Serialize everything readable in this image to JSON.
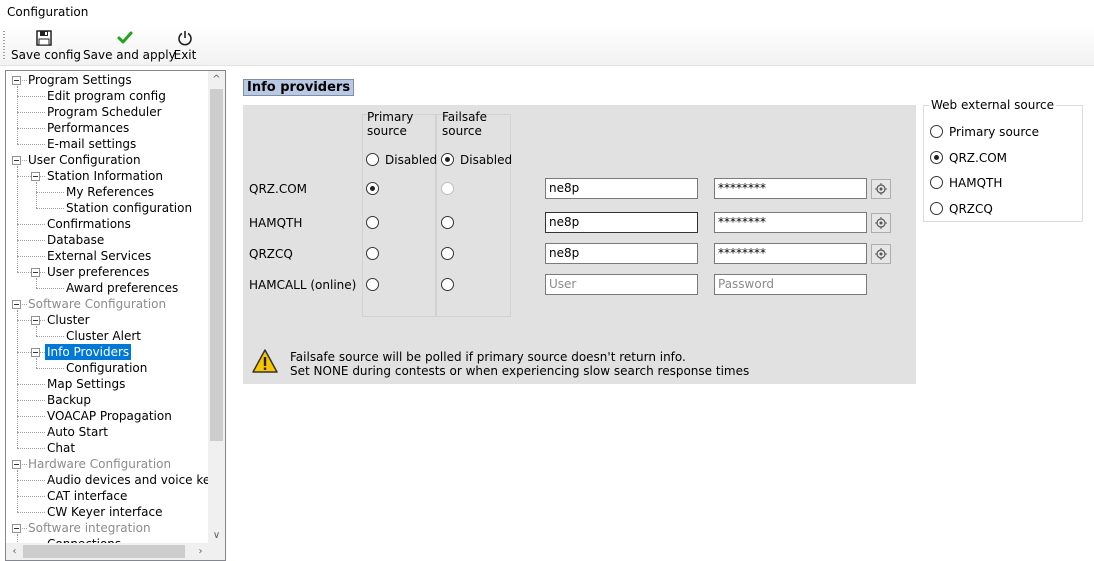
{
  "window": {
    "title": "Configuration"
  },
  "toolbar": {
    "save_config": "Save config",
    "save_and_apply": "Save and apply",
    "exit": "Exit"
  },
  "tree": {
    "items": [
      {
        "label": "Program Settings",
        "level": 0,
        "group": true
      },
      {
        "label": "Edit program config",
        "level": 1
      },
      {
        "label": "Program Scheduler",
        "level": 1
      },
      {
        "label": "Performances",
        "level": 1
      },
      {
        "label": "E-mail settings",
        "level": 1
      },
      {
        "label": "User Configuration",
        "level": 0,
        "group": true
      },
      {
        "label": "Station Information",
        "level": 1,
        "group": true
      },
      {
        "label": "My References",
        "level": 2
      },
      {
        "label": "Station configuration",
        "level": 2
      },
      {
        "label": "Confirmations",
        "level": 1
      },
      {
        "label": "Database",
        "level": 1
      },
      {
        "label": "External Services",
        "level": 1
      },
      {
        "label": "User preferences",
        "level": 1,
        "group": true
      },
      {
        "label": "Award preferences",
        "level": 2
      },
      {
        "label": "Software Configuration",
        "level": 0,
        "group": true,
        "grey": true
      },
      {
        "label": "Cluster",
        "level": 1,
        "group": true
      },
      {
        "label": "Cluster Alert",
        "level": 2
      },
      {
        "label": "Info Providers",
        "level": 1,
        "group": true,
        "selected": true
      },
      {
        "label": "Configuration",
        "level": 2
      },
      {
        "label": "Map Settings",
        "level": 1
      },
      {
        "label": "Backup",
        "level": 1
      },
      {
        "label": "VOACAP Propagation",
        "level": 1
      },
      {
        "label": "Auto Start",
        "level": 1
      },
      {
        "label": "Chat",
        "level": 1
      },
      {
        "label": "Hardware Configuration",
        "level": 0,
        "group": true,
        "grey": true
      },
      {
        "label": "Audio devices and voice keyer",
        "level": 1
      },
      {
        "label": "CAT interface",
        "level": 1
      },
      {
        "label": "CW Keyer interface",
        "level": 1
      },
      {
        "label": "Software integration",
        "level": 0,
        "group": true,
        "grey": true
      },
      {
        "label": "Connections",
        "level": 1
      }
    ]
  },
  "panel": {
    "title": "Info providers",
    "primary_header": "Primary\nsource",
    "failsafe_header": "Failsafe\nsource",
    "primary_disabled_label": "Disabled",
    "failsafe_disabled_label": "Disabled",
    "rows": [
      {
        "name": "QRZ.COM",
        "user": "ne8p",
        "password": "********",
        "primary": true,
        "failsafe": false,
        "failsafe_disabled": true,
        "has_button": true
      },
      {
        "name": "HAMQTH",
        "user": "ne8p",
        "password": "********",
        "primary": false,
        "failsafe": false,
        "has_button": true,
        "focused": true
      },
      {
        "name": "QRZCQ",
        "user": "ne8p",
        "password": "********",
        "primary": false,
        "failsafe": false,
        "has_button": true
      },
      {
        "name": "HAMCALL (online)",
        "user": "",
        "password": "",
        "user_placeholder": "User",
        "password_placeholder": "Password",
        "primary": false,
        "failsafe": false,
        "has_button": false
      }
    ],
    "notice_line1": "Failsafe source will be polled if primary source doesn't return info.",
    "notice_line2": "Set NONE during contests or when experiencing slow search response times"
  },
  "web_source": {
    "legend": "Web external source",
    "options": [
      "Primary source",
      "QRZ.COM",
      "HAMQTH",
      "QRZCQ"
    ],
    "selected": "QRZ.COM"
  },
  "colors": {
    "selection": "#0078d7",
    "panel_bg": "#e1e1e1",
    "title_bg": "#b9c9e3"
  }
}
